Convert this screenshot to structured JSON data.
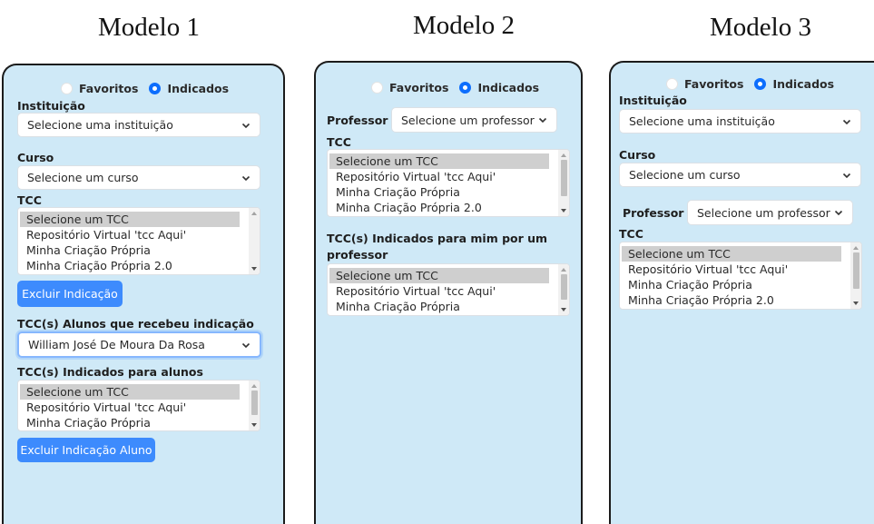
{
  "titles": [
    "Modelo 1",
    "Modelo 2",
    "Modelo 3"
  ],
  "icons": {
    "chevron": "chevron-down-icon"
  },
  "colors": {
    "panel_bg": "#cfe9f7",
    "accent": "#0d6efd",
    "button": "#3d8bfd"
  },
  "model1": {
    "radio_favoritos": "Favoritos",
    "radio_indicados": "Indicados",
    "radio_selected": "Indicados",
    "instituicao_label": "Instituição",
    "instituicao_value": "Selecione uma instituição",
    "curso_label": "Curso",
    "curso_value": "Selecione um curso",
    "tcc_label": "TCC",
    "tcc_options": [
      "Selecione um TCC",
      "Repositório Virtual 'tcc Aqui'",
      "Minha Criação Própria",
      "Minha Criação Própria 2.0"
    ],
    "excluir_button": "Excluir Indicação",
    "alunos_label": "TCC(s) Alunos que recebeu indicação",
    "alunos_value": "William José De Moura Da Rosa",
    "indicados_label": "TCC(s) Indicados para alunos",
    "indicados_options": [
      "Selecione um TCC",
      "Repositório Virtual 'tcc Aqui'",
      "Minha Criação Própria"
    ],
    "excluir_aluno_button": "Excluir Indicação Aluno"
  },
  "model2": {
    "radio_favoritos": "Favoritos",
    "radio_indicados": "Indicados",
    "radio_selected": "Indicados",
    "professor_label": "Professor",
    "professor_value": "Selecione um professor",
    "tcc_label": "TCC",
    "tcc_options": [
      "Selecione um TCC",
      "Repositório Virtual 'tcc Aqui'",
      "Minha Criação Própria",
      "Minha Criação Própria 2.0"
    ],
    "indicados_label_line1": "TCC(s) Indicados para mim por um",
    "indicados_label_line2": "professor",
    "indicados_options": [
      "Selecione um TCC",
      "Repositório Virtual 'tcc Aqui'",
      "Minha Criação Própria"
    ]
  },
  "model3": {
    "radio_favoritos": "Favoritos",
    "radio_indicados": "Indicados",
    "radio_selected": "Indicados",
    "instituicao_label": "Instituição",
    "instituicao_value": "Selecione uma instituição",
    "curso_label": "Curso",
    "curso_value": "Selecione um curso",
    "professor_label": "Professor",
    "professor_value": "Selecione um professor",
    "tcc_label": "TCC",
    "tcc_options": [
      "Selecione um TCC",
      "Repositório Virtual 'tcc Aqui'",
      "Minha Criação Própria",
      "Minha Criação Própria 2.0"
    ]
  }
}
